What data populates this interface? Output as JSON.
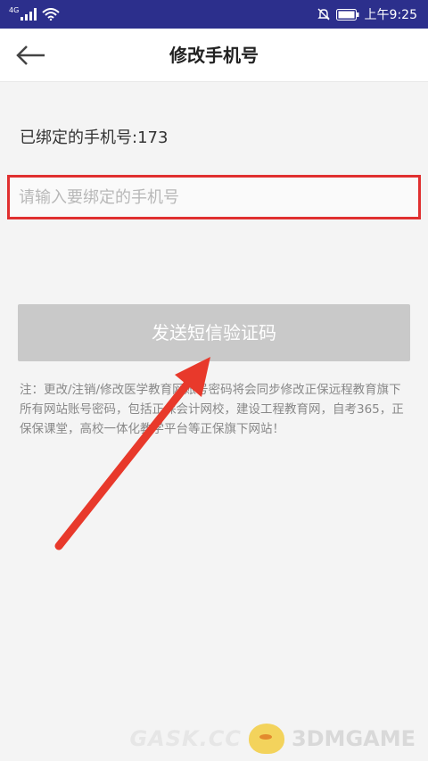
{
  "statusbar": {
    "network": "4G",
    "time": "上午9:25"
  },
  "appbar": {
    "title": "修改手机号"
  },
  "bound_phone": "已绑定的手机号:173",
  "input": {
    "placeholder": "请输入要绑定的手机号",
    "value": ""
  },
  "send_button": "发送短信验证码",
  "note": "注：更改/注销/修改医学教育网账号密码将会同步修改正保远程教育旗下所有网站账号密码，包括正保会计网校，建设工程教育网，自考365，正保保课堂，高校一体化教学平台等正保旗下网站！",
  "watermark": {
    "left": "GASK.CC",
    "right": "3DMGAME"
  },
  "colors": {
    "statusbar": "#2c2f8c",
    "highlight_border": "#e03030",
    "arrow": "#e8392b",
    "button_disabled": "#c9c9c9"
  },
  "icons": [
    "signal-icon",
    "wifi-icon",
    "mute-bell-icon",
    "battery-icon",
    "back-arrow-icon"
  ]
}
